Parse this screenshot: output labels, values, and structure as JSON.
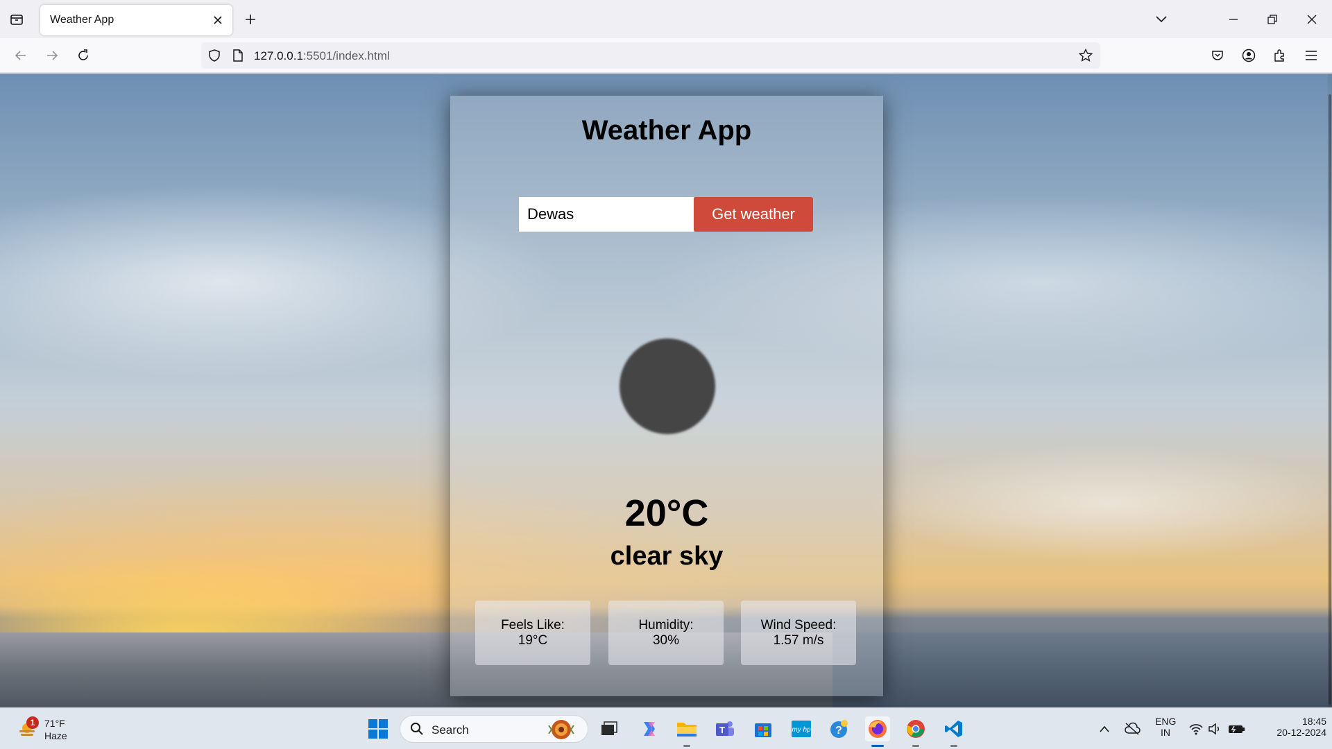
{
  "browser": {
    "tab_title": "Weather App",
    "url_host": "127.0.0.1",
    "url_rest": ":5501/index.html"
  },
  "page": {
    "title": "Weather App",
    "city_value": "Dewas",
    "button_label": "Get weather",
    "temperature": "20°C",
    "description": "clear sky",
    "details": [
      {
        "label": "Feels Like:",
        "value": "19°C"
      },
      {
        "label": "Humidity:",
        "value": "30%"
      },
      {
        "label": "Wind Speed:",
        "value": "1.57 m/s"
      }
    ],
    "button_color": "#cf4a3a"
  },
  "taskbar": {
    "weather_temp": "71°F",
    "weather_cond": "Haze",
    "weather_badge": "1",
    "search_label": "Search",
    "lang_line1": "ENG",
    "lang_line2": "IN",
    "time": "18:45",
    "date": "20-12-2024"
  }
}
